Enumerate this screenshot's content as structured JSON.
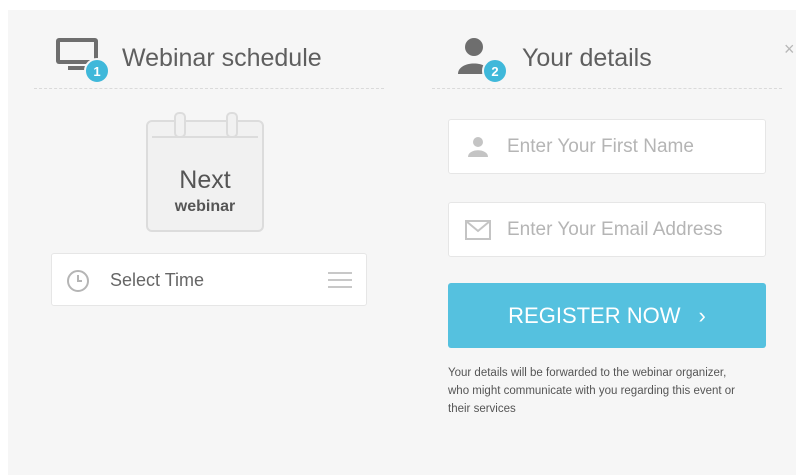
{
  "close": {
    "glyph": "×"
  },
  "schedule": {
    "heading": "Webinar schedule",
    "step": "1",
    "calendar": {
      "line1": "Next",
      "line2": "webinar"
    },
    "select_time": {
      "label": "Select Time"
    }
  },
  "details": {
    "heading": "Your details",
    "step": "2",
    "first_name": {
      "placeholder": "Enter Your First Name",
      "value": ""
    },
    "email": {
      "placeholder": "Enter Your Email Address",
      "value": ""
    },
    "register": {
      "label": "REGISTER NOW",
      "arrow": "›"
    },
    "note": "Your details will be forwarded to the webinar organizer, who might communicate with you regarding this event or their services"
  },
  "colors": {
    "accent": "#55c1df",
    "badge": "#3fb8da",
    "panel_bg": "#f6f6f6"
  },
  "icons": [
    "monitor-icon",
    "user-icon",
    "calendar-icon",
    "clock-icon",
    "menu-icon",
    "envelope-icon",
    "close-icon"
  ]
}
